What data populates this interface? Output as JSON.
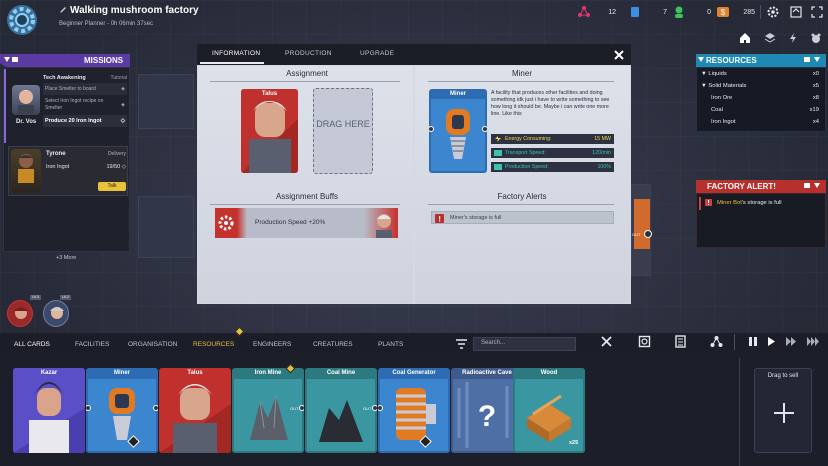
{
  "top": {
    "factory_name": "Walking mushroom factory",
    "subtitle": "Beginner Planner - 0h 06min 37sec",
    "resources": [
      {
        "icon": "molecule-icon",
        "value": "12"
      },
      {
        "icon": "crystal-icon",
        "value": "7"
      },
      {
        "icon": "person-icon",
        "value": "0"
      },
      {
        "icon": "coin-icon",
        "value": "285"
      }
    ]
  },
  "missions": {
    "title": "MISSIONS",
    "tech_awakening": {
      "title": "Tech Awakening",
      "tag": "Tutorial",
      "owner": "Dr. Vos",
      "tasks": [
        "Place Smelter to board",
        "Select Iron Ingot recipe on Smelter",
        "Produce 20 Iron Ingot"
      ]
    },
    "delivery": {
      "name": "Tyrone",
      "tag": "Delivery",
      "item": "Iron Ingot",
      "progress": "19/50",
      "button": "Talk"
    },
    "more": "+3 More"
  },
  "modal": {
    "tabs": [
      "INFORMATION",
      "PRODUCTION",
      "UPGRADE"
    ],
    "assignment_title": "Assignment",
    "engineer_card": "Talus",
    "drag_here": "DRAG HERE",
    "buffs_title": "Assignment Buffs",
    "buff_text": "Production Speed +20%",
    "facility_title": "Miner",
    "facility_card": "Miner",
    "description": "A facility that produces other facilities and doing something idk just i have to write something to see how long it should be. Maybe i can write one more line. Like this",
    "stats": [
      {
        "label": "Energy Consuming:",
        "value": "15 MW"
      },
      {
        "label": "Transport Speed:",
        "value": "120/min"
      },
      {
        "label": "Production Speed:",
        "value": "100%"
      }
    ],
    "alerts_title": "Factory Alerts",
    "alert_text": "Miner's storage is full"
  },
  "resources_panel": {
    "title": "RESOURCES",
    "rows": [
      {
        "name": "Liquids",
        "value": "x0",
        "group": true
      },
      {
        "name": "Solid Materials",
        "value": "x5",
        "group": true
      },
      {
        "name": "Iron Ore",
        "value": "x8",
        "group": false
      },
      {
        "name": "Coal",
        "value": "x19",
        "group": false
      },
      {
        "name": "Iron Ingot",
        "value": "x4",
        "group": false
      }
    ]
  },
  "factory_alert": {
    "title": "FACTORY ALERT!",
    "name": "Miner Bot",
    "text": "'s storage is full"
  },
  "bottom": {
    "tabs": [
      "ALL CARDS",
      "FACILITIES",
      "ORGANISATION",
      "RESOURCES",
      "ENGINEERS",
      "CREATURES",
      "PLANTS"
    ],
    "search_placeholder": "Search...",
    "cards": [
      "Kazar",
      "Miner",
      "Talus",
      "Iron Mine",
      "Coal Mine",
      "Coal Generator",
      "Radioactive Cave",
      "Wood"
    ],
    "wood_count": "x25",
    "drag_to_sell": "Drag to sell",
    "out_label": "OUT",
    "level_badges": [
      "LV.3",
      "LV.2"
    ]
  },
  "colors": {
    "background": "#2a2d3b",
    "mission_header": "#5b3aa3",
    "resources_header": "#1e8ab3",
    "alert_header": "#b8302c",
    "active_tab": "#e9c23b",
    "stat_text": "#e8d84a"
  }
}
